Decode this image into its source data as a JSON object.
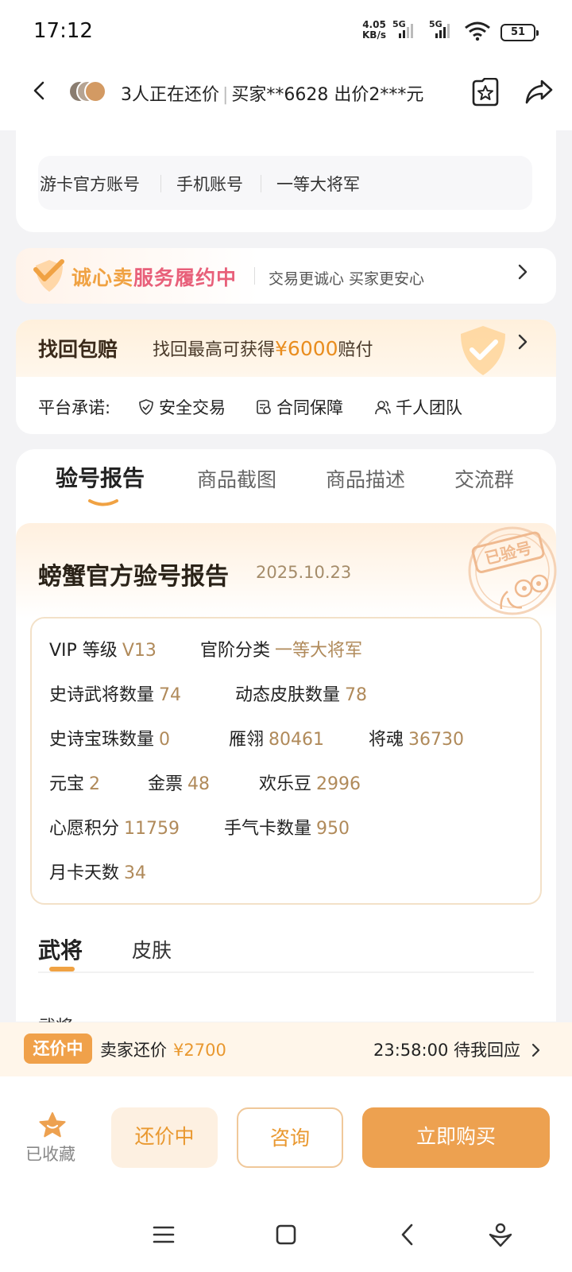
{
  "status_bar": {
    "time": "17:12",
    "net_speed_value": "4.05",
    "net_speed_unit": "KB/s",
    "sim1": "5G",
    "sim2": "5G",
    "battery": "51"
  },
  "header": {
    "title": "3人正在还价",
    "subtitle": "买家**6628 出价2***元"
  },
  "account_tags": [
    "游卡官方账号",
    "手机账号",
    "一等大将军"
  ],
  "sincere_banner": {
    "title_prefix": "诚心卖",
    "title_suffix": "服务履约中",
    "subtitle": "交易更诚心 买家更安心"
  },
  "recovery": {
    "title": "找回包赔",
    "text_prefix": "找回最高可获得",
    "amount": "¥6000",
    "text_suffix": "赔付"
  },
  "platform_promise": {
    "label": "平台承诺:",
    "items": [
      "安全交易",
      "合同保障",
      "千人团队"
    ]
  },
  "report_tabs": [
    "验号报告",
    "商品截图",
    "商品描述",
    "交流群"
  ],
  "report": {
    "title": "螃蟹官方验号报告",
    "date": "2025.10.23",
    "stamp_text": "已验号",
    "stats": [
      {
        "label": "VIP 等级",
        "value": "V13"
      },
      {
        "label": "官阶分类",
        "value": "一等大将军"
      },
      {
        "label": "史诗武将数量",
        "value": "74"
      },
      {
        "label": "动态皮肤数量",
        "value": "78"
      },
      {
        "label": "史诗宝珠数量",
        "value": "0"
      },
      {
        "label": "雁翎",
        "value": "80461"
      },
      {
        "label": "将魂",
        "value": "36730"
      },
      {
        "label": "元宝",
        "value": "2"
      },
      {
        "label": "金票",
        "value": "48"
      },
      {
        "label": "欢乐豆",
        "value": "2996"
      },
      {
        "label": "心愿积分",
        "value": "11759"
      },
      {
        "label": "手气卡数量",
        "value": "950"
      },
      {
        "label": "月卡天数",
        "value": "34"
      }
    ]
  },
  "sub_tabs": [
    "武将",
    "皮肤"
  ],
  "cut_text_below": "武将",
  "counter_offer": {
    "badge": "还价中",
    "label": "卖家还价",
    "price": "¥2700",
    "time_text": "23:58:00 待我回应"
  },
  "bottom_bar": {
    "fav_label": "已收藏",
    "counter_button": "还价中",
    "consult_button": "咨询",
    "buy_button": "立即购买"
  },
  "colors": {
    "accent": "#eda150",
    "value_text": "#b08a5a",
    "pink_title": "#e8607a"
  }
}
